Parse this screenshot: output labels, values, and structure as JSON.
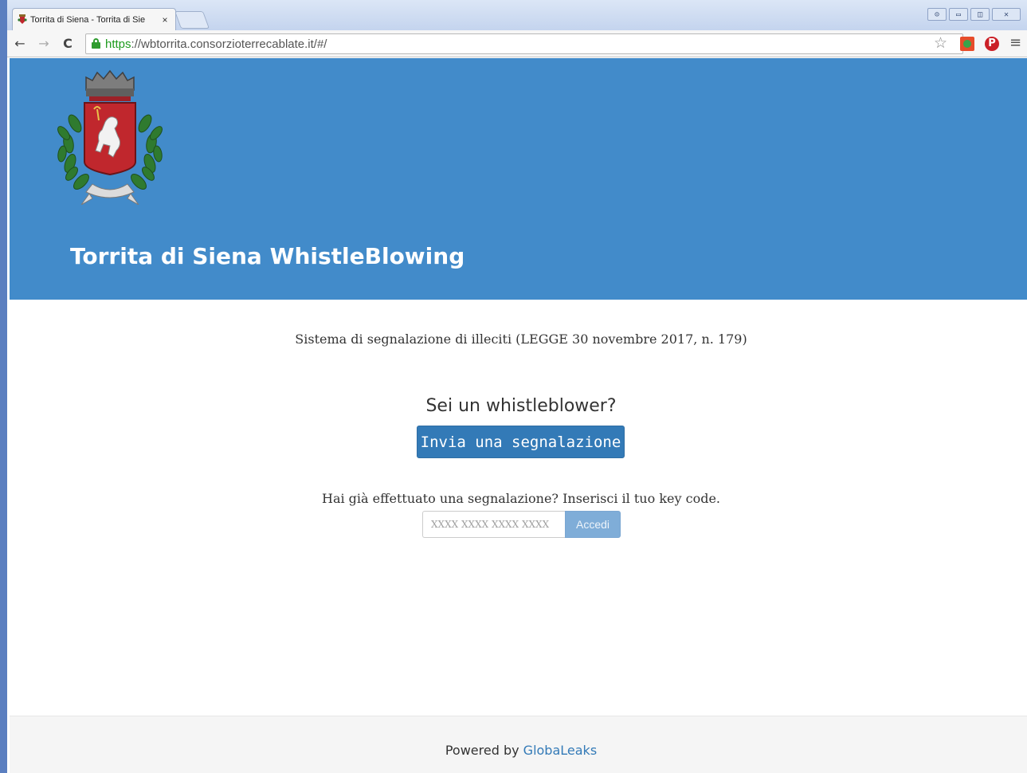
{
  "browser": {
    "tab_title": "Torrita di Siena - Torrita di Sie",
    "tab_close": "×",
    "window_buttons": [
      "⊝",
      "▭",
      "◫",
      "✕"
    ],
    "url_scheme": "https",
    "url_rest": "://wbtorrita.consorzioterrecablate.it/#/",
    "nav_back": "←",
    "nav_forward": "→",
    "nav_reload": "C",
    "bookmark_star": "☆",
    "extension_pin": "P",
    "menu": "≡"
  },
  "header": {
    "title": "Torrita di Siena WhistleBlowing",
    "background": "#428bca"
  },
  "main": {
    "subtitle": "Sistema di segnalazione di illeciti (LEGGE 30 novembre 2017, n. 179)",
    "question": "Sei un whistleblower?",
    "submit_button": "Invia una segnalazione",
    "keycode_label": "Hai già effettuato una segnalazione? Inserisci il tuo key code.",
    "keycode_placeholder": "XXXX XXXX XXXX XXXX",
    "access_button": "Accedi"
  },
  "footer": {
    "powered_by": "Powered by",
    "link_text": "GlobaLeaks"
  },
  "colors": {
    "primary": "#337ab7",
    "header_blue": "#428bca"
  }
}
